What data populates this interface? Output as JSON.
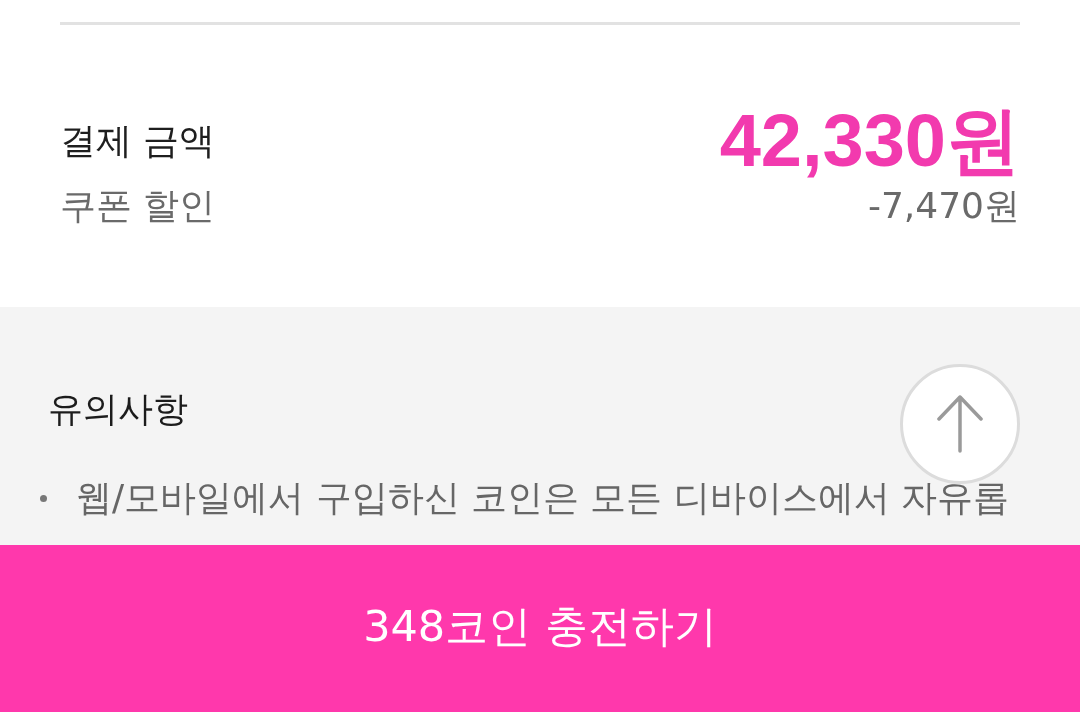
{
  "summary": {
    "rows": [
      {
        "kind": "total",
        "label": "결제 금액",
        "value": "42,330원"
      },
      {
        "kind": "discount",
        "label": "쿠폰 할인",
        "value": "-7,470원"
      }
    ]
  },
  "notice": {
    "title": "유의사항",
    "items": [
      "웹/모바일에서 구입하신 코인은 모든 디바이스에서 자유롭"
    ]
  },
  "charge_button": {
    "label": "348코인 충전하기"
  }
}
